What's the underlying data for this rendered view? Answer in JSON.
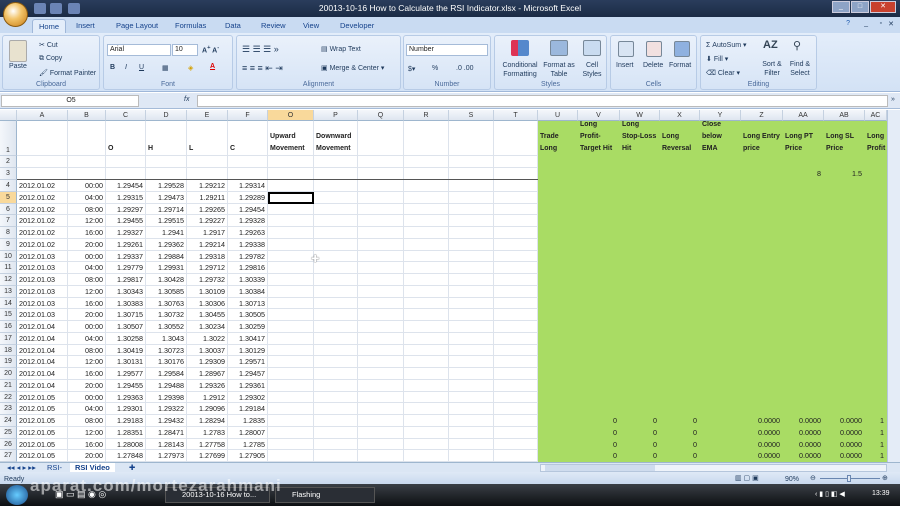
{
  "window": {
    "title": "20013-10-16 How to Calculate the RSI Indicator.xlsx - Microsoft Excel"
  },
  "ribbon_tabs": [
    "Home",
    "Insert",
    "Page Layout",
    "Formulas",
    "Data",
    "Review",
    "View",
    "Developer"
  ],
  "clipboard": {
    "paste": "Paste",
    "cut": "Cut",
    "copy": "Copy",
    "format_painter": "Format Painter",
    "label": "Clipboard"
  },
  "font": {
    "name": "Arial",
    "size": "10",
    "bold": "B",
    "italic": "I",
    "underline": "U",
    "label": "Font"
  },
  "alignment": {
    "wrap": "Wrap Text",
    "merge": "Merge & Center",
    "label": "Alignment"
  },
  "number": {
    "format": "Number",
    "percent": "%",
    "label": "Number"
  },
  "styles": {
    "conditional": "Conditional Formatting",
    "table": "Format as Table",
    "cell": "Cell Styles",
    "label": "Styles"
  },
  "cells": {
    "insert": "Insert",
    "delete": "Delete",
    "format": "Format",
    "label": "Cells"
  },
  "editing": {
    "autosum": "AutoSum",
    "fill": "Fill",
    "clear": "Clear",
    "sort": "Sort & Filter",
    "find": "Find & Select",
    "label": "Editing"
  },
  "formula_bar": {
    "name_box": "O5",
    "fx": "fx",
    "value": ""
  },
  "columns": [
    "A",
    "B",
    "C",
    "D",
    "E",
    "F",
    "O",
    "P",
    "Q",
    "R",
    "S",
    "T",
    "U",
    "V",
    "W",
    "X",
    "Y",
    "Z",
    "AA",
    "AB",
    "AC"
  ],
  "headers": {
    "C": "O",
    "D": "H",
    "E": "L",
    "F": "C",
    "O": "Upward Movement",
    "P": "Downward Movement",
    "U": "Trade Long",
    "V": "Long Profit-Target Hit",
    "W": "Long Stop-Loss Hit",
    "X": "Long Reversal",
    "Y": "Close below EMA",
    "Z": "Long Entry price",
    "AA": "Long PT Price",
    "AB": "Long SL Price",
    "AC": "Long Profit"
  },
  "row3": {
    "AA": "8",
    "AB": "1.5"
  },
  "rows": [
    [
      "4",
      "2012.01.02",
      "00:00",
      "1.29454",
      "1.29528",
      "1.29212",
      "1.29314"
    ],
    [
      "5",
      "2012.01.02",
      "04:00",
      "1.29315",
      "1.29473",
      "1.29211",
      "1.29289"
    ],
    [
      "6",
      "2012.01.02",
      "08:00",
      "1.29297",
      "1.29714",
      "1.29265",
      "1.29454"
    ],
    [
      "7",
      "2012.01.02",
      "12:00",
      "1.29455",
      "1.29515",
      "1.29227",
      "1.29328"
    ],
    [
      "8",
      "2012.01.02",
      "16:00",
      "1.29327",
      "1.2941",
      "1.2917",
      "1.29263"
    ],
    [
      "9",
      "2012.01.02",
      "20:00",
      "1.29261",
      "1.29362",
      "1.29214",
      "1.29338"
    ],
    [
      "10",
      "2012.01.03",
      "00:00",
      "1.29337",
      "1.29884",
      "1.29318",
      "1.29782"
    ],
    [
      "11",
      "2012.01.03",
      "04:00",
      "1.29779",
      "1.29931",
      "1.29712",
      "1.29816"
    ],
    [
      "12",
      "2012.01.03",
      "08:00",
      "1.29817",
      "1.30428",
      "1.29732",
      "1.30339"
    ],
    [
      "13",
      "2012.01.03",
      "12:00",
      "1.30343",
      "1.30585",
      "1.30109",
      "1.30384"
    ],
    [
      "14",
      "2012.01.03",
      "16:00",
      "1.30383",
      "1.30763",
      "1.30306",
      "1.30713"
    ],
    [
      "15",
      "2012.01.03",
      "20:00",
      "1.30715",
      "1.30732",
      "1.30455",
      "1.30505"
    ],
    [
      "16",
      "2012.01.04",
      "00:00",
      "1.30507",
      "1.30552",
      "1.30234",
      "1.30259"
    ],
    [
      "17",
      "2012.01.04",
      "04:00",
      "1.30258",
      "1.3043",
      "1.3022",
      "1.30417"
    ],
    [
      "18",
      "2012.01.04",
      "08:00",
      "1.30419",
      "1.30723",
      "1.30037",
      "1.30129"
    ],
    [
      "19",
      "2012.01.04",
      "12:00",
      "1.30131",
      "1.30176",
      "1.29309",
      "1.29571"
    ],
    [
      "20",
      "2012.01.04",
      "16:00",
      "1.29577",
      "1.29584",
      "1.28967",
      "1.29457"
    ],
    [
      "21",
      "2012.01.04",
      "20:00",
      "1.29455",
      "1.29488",
      "1.29326",
      "1.29361"
    ],
    [
      "22",
      "2012.01.05",
      "00:00",
      "1.29363",
      "1.29398",
      "1.2912",
      "1.29302"
    ],
    [
      "23",
      "2012.01.05",
      "04:00",
      "1.29301",
      "1.29322",
      "1.29096",
      "1.29184"
    ],
    [
      "24",
      "2012.01.05",
      "08:00",
      "1.29183",
      "1.29432",
      "1.28294",
      "1.2835"
    ],
    [
      "25",
      "2012.01.05",
      "12:00",
      "1.28351",
      "1.28471",
      "1.2783",
      "1.28007"
    ],
    [
      "26",
      "2012.01.05",
      "16:00",
      "1.28008",
      "1.28143",
      "1.27758",
      "1.2785"
    ],
    [
      "27",
      "2012.01.05",
      "20:00",
      "1.27848",
      "1.27973",
      "1.27699",
      "1.27905"
    ]
  ],
  "signal_rows_from": "24",
  "signal_values": {
    "V": "0",
    "W": "0",
    "X": "0",
    "Z": "0.0000",
    "AA": "0.0000",
    "AB": "0.0000",
    "AC": "1"
  },
  "sheets": [
    "RSI-",
    "RSI Video"
  ],
  "active_sheet": "RSI Video",
  "status": {
    "ready": "Ready",
    "zoom": "90%"
  },
  "taskbar": {
    "items": [
      "20013-10-16 How to...",
      "Flashing"
    ],
    "clock": "13:39"
  },
  "watermark": "aparat.com/mortezarahmani",
  "colors": {
    "green_area": "#a9dc64",
    "selection_header": "#f9d99b"
  }
}
